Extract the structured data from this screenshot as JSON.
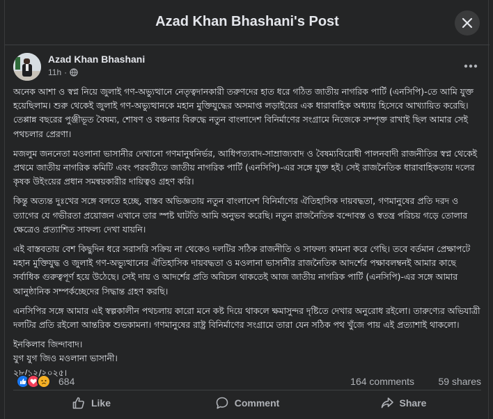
{
  "modal": {
    "title": "Azad Khan Bhashani's Post",
    "close_icon": "close-icon"
  },
  "post": {
    "author": "Azad Khan Bhashani",
    "time": "11h",
    "separator": "·",
    "privacy_icon": "globe-icon",
    "paragraphs": [
      "অনেক আশা ও স্বপ্ন নিয়ে জুলাই গণ-অভ্যুত্থানে নেতৃত্বদানকারী তরুণদের হাত ধরে গঠিত জাতীয় নাগরিক পার্টি (এনসিপি)-তে আমি যুক্ত হয়েছিলাম। শুরু থেকেই জুলাই গণ-অভ্যুত্থানকে মহান মুক্তিযুদ্ধের অসমাপ্ত লড়াইয়ের এক ধারাবাহিক অধ্যায় হিসেবে আখ্যায়িত করেছি। তেপ্পান্ন বছরের পুঞ্জীভূত বৈষম্য, শোষণ ও বঞ্চনার বিরুদ্ধে নতুন বাংলাদেশ বিনির্মাণের সংগ্রামে নিজেকে সম্পৃক্ত রাখাই ছিল আমার সেই পথচলার প্রেরণা।",
      "মজলুম জননেতা মওলানা ভাসানীর দেখানো গণমানুষনির্ভর, আধিপত্যবাদ-সাম্রাজ্যবাদ ও বৈষম্যবিরোধী পালনবাদী রাজনীতির স্বপ্ন থেকেই প্রথমে জাতীয় নাগরিক কমিটি এবং পরবর্তীতে জাতীয় নাগরিক পার্টি (এনসিপি)-এর সঙ্গে যুক্ত হই। সেই রাজনৈতিক ধারাবাহিকতায় দলের কৃষক উইংয়ের প্রধান সমন্বয়কারীর দায়িত্বও গ্রহণ করি।",
      "কিন্তু অত্যন্ত দুঃখের সঙ্গে বলতে হচ্ছে, বাস্তব অভিজ্ঞতায় নতুন বাংলাদেশ বিনির্মাণের ঐতিহাসিক দায়বদ্ধতা, গণমানুষের প্রতি দরদ ও ত্যাগের যে গভীরতা প্রয়োজন এখানে তার স্পষ্ট ঘাটতি আমি অনুভব করেছি। নতুন রাজনৈতিক বন্দোবস্ত ও স্বতন্ত্র পরিচয় গড়ে তোলার ক্ষেত্রেও প্রত্যাশিত সাফল্য দেখা যায়নি।",
      "এই বাস্তবতায় বেশ কিছুদিন ধরে সরাসরি সক্রিয় না থেকেও দলটির সঠিক রাজনীতি ও সাফল্য কামনা করে গেছি। তবে বর্তমান প্রেক্ষাপটে মহান মুক্তিযুদ্ধ ও জুলাই গণ-অভ্যুত্থানের ঐতিহাসিক দায়বদ্ধতা ও মওলানা ভাসানীর রাজনৈতিক আদর্শের পক্ষাবলম্বনই আমার কাছে সর্বাধিক গুরুত্বপূর্ণ হয়ে উঠেছে। সেই দায় ও আদর্শের প্রতি অবিচল থাকতেই আজ জাতীয় নাগরিক পার্টি (এনসিপি)-এর সঙ্গে আমার আনুষ্ঠানিক সম্পর্কচ্ছেদের সিদ্ধান্ত গ্রহণ করছি।",
      "এনসিপির সঙ্গে আমার এই স্বল্পকালীন পথচলায় কারো মনে কষ্ট দিয়ে থাকলে ক্ষমাসুন্দর দৃষ্টিতে দেখার অনুরোধ রইলো। তারুণ্যের অভিযাত্রী দলটির প্রতি রইলো আন্তরিক শুভকামনা। গণমানুষের রাষ্ট্র বিনির্মাণের সংগ্রামে তারা যেন সঠিক পথ খুঁজে পায় এই প্রত্যাশাই থাকলো।"
    ],
    "signoff": [
      "ইনকিলাব জিন্দাবাদ।",
      "যুগ যুগ জিও মওলানা ভাসানী।",
      "২৮/১২/২০২৫।"
    ]
  },
  "stats": {
    "reactions": "684",
    "reaction_icons": [
      "like-icon",
      "love-icon",
      "sad-icon"
    ],
    "comments": "164 comments",
    "shares": "59 shares"
  },
  "actions": {
    "like": "Like",
    "comment": "Comment",
    "share": "Share"
  },
  "colors": {
    "background": "#242526",
    "text": "#e4e6eb",
    "secondary": "#b0b3b8",
    "like_blue": "#1877f2",
    "love_red": "#f33e58",
    "sad_yellow": "#f7b125"
  }
}
